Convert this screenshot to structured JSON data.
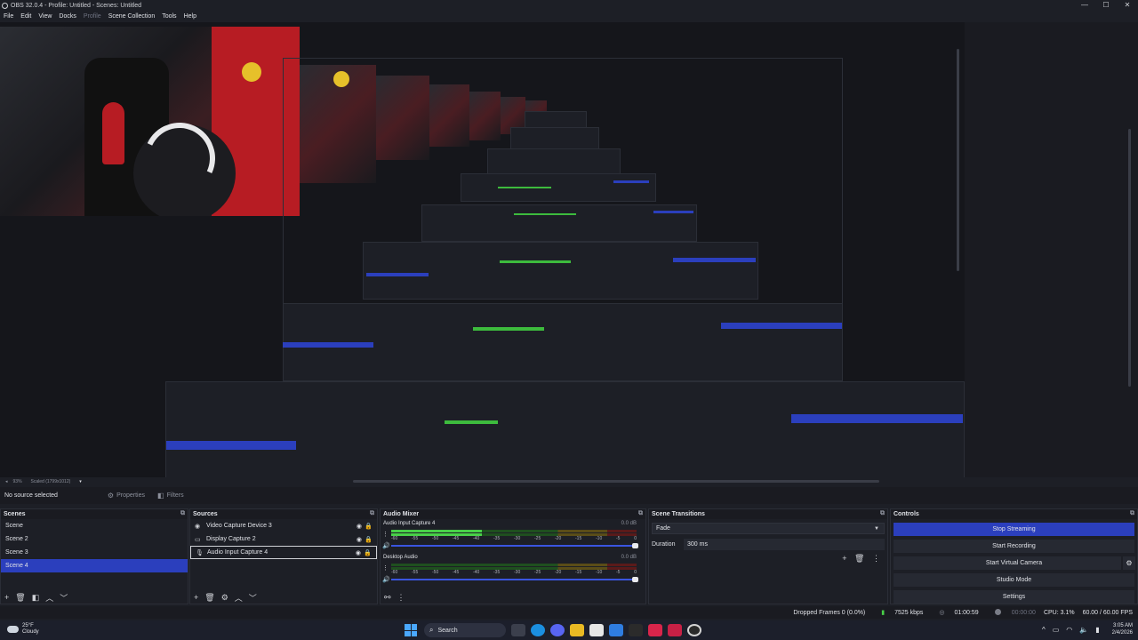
{
  "window": {
    "title": "OBS 32.0.4 - Profile: Untitled - Scenes: Untitled",
    "minimize": "—",
    "maximize": "☐",
    "close": "✕"
  },
  "menu": [
    "File",
    "Edit",
    "View",
    "Docks",
    "Profile",
    "Scene Collection",
    "Tools",
    "Help"
  ],
  "preview": {
    "zoom": "93%",
    "scale": "Scaled (1799x1012)"
  },
  "source_toolbar": {
    "no_source": "No source selected",
    "properties": "Properties",
    "filters": "Filters"
  },
  "scenes": {
    "title": "Scenes",
    "items": [
      "Scene",
      "Scene 2",
      "Scene 3",
      "Scene 4"
    ],
    "selected": "Scene 4"
  },
  "sources": {
    "title": "Sources",
    "items": [
      {
        "name": "Video Capture Device 3",
        "icon": "camera-icon"
      },
      {
        "name": "Display Capture 2",
        "icon": "monitor-icon"
      },
      {
        "name": "Audio Input Capture 4",
        "icon": "microphone-icon"
      }
    ]
  },
  "mixer": {
    "title": "Audio Mixer",
    "channels": [
      {
        "name": "Audio Input Capture 4",
        "db": "0.0 dB",
        "level": 0.37
      },
      {
        "name": "Desktop Audio",
        "db": "0.0 dB",
        "level": 0.0
      }
    ],
    "scale": [
      "-60",
      "-55",
      "-50",
      "-45",
      "-40",
      "-35",
      "-30",
      "-25",
      "-20",
      "-15",
      "-10",
      "-5",
      "0"
    ]
  },
  "transitions": {
    "title": "Scene Transitions",
    "selected": "Fade",
    "duration_label": "Duration",
    "duration_value": "300 ms"
  },
  "controls": {
    "title": "Controls",
    "stop_streaming": "Stop Streaming",
    "start_recording": "Start Recording",
    "start_virtual_camera": "Start Virtual Camera",
    "studio_mode": "Studio Mode",
    "settings": "Settings"
  },
  "status": {
    "dropped": "Dropped Frames 0 (0.0%)",
    "bitrate": "7525 kbps",
    "stream_time": "01:00:59",
    "rec_time": "00:00:00",
    "cpu": "CPU: 3.1%",
    "fps": "60.00 / 60.00 FPS"
  },
  "taskbar": {
    "temp": "25°F",
    "condition": "Cloudy",
    "search": "Search",
    "time": "3:05 AM",
    "date": "2/4/2026"
  },
  "colors": {
    "accent": "#2b3fbd",
    "meter_green": "#48d048",
    "background": "#1d1f26"
  }
}
